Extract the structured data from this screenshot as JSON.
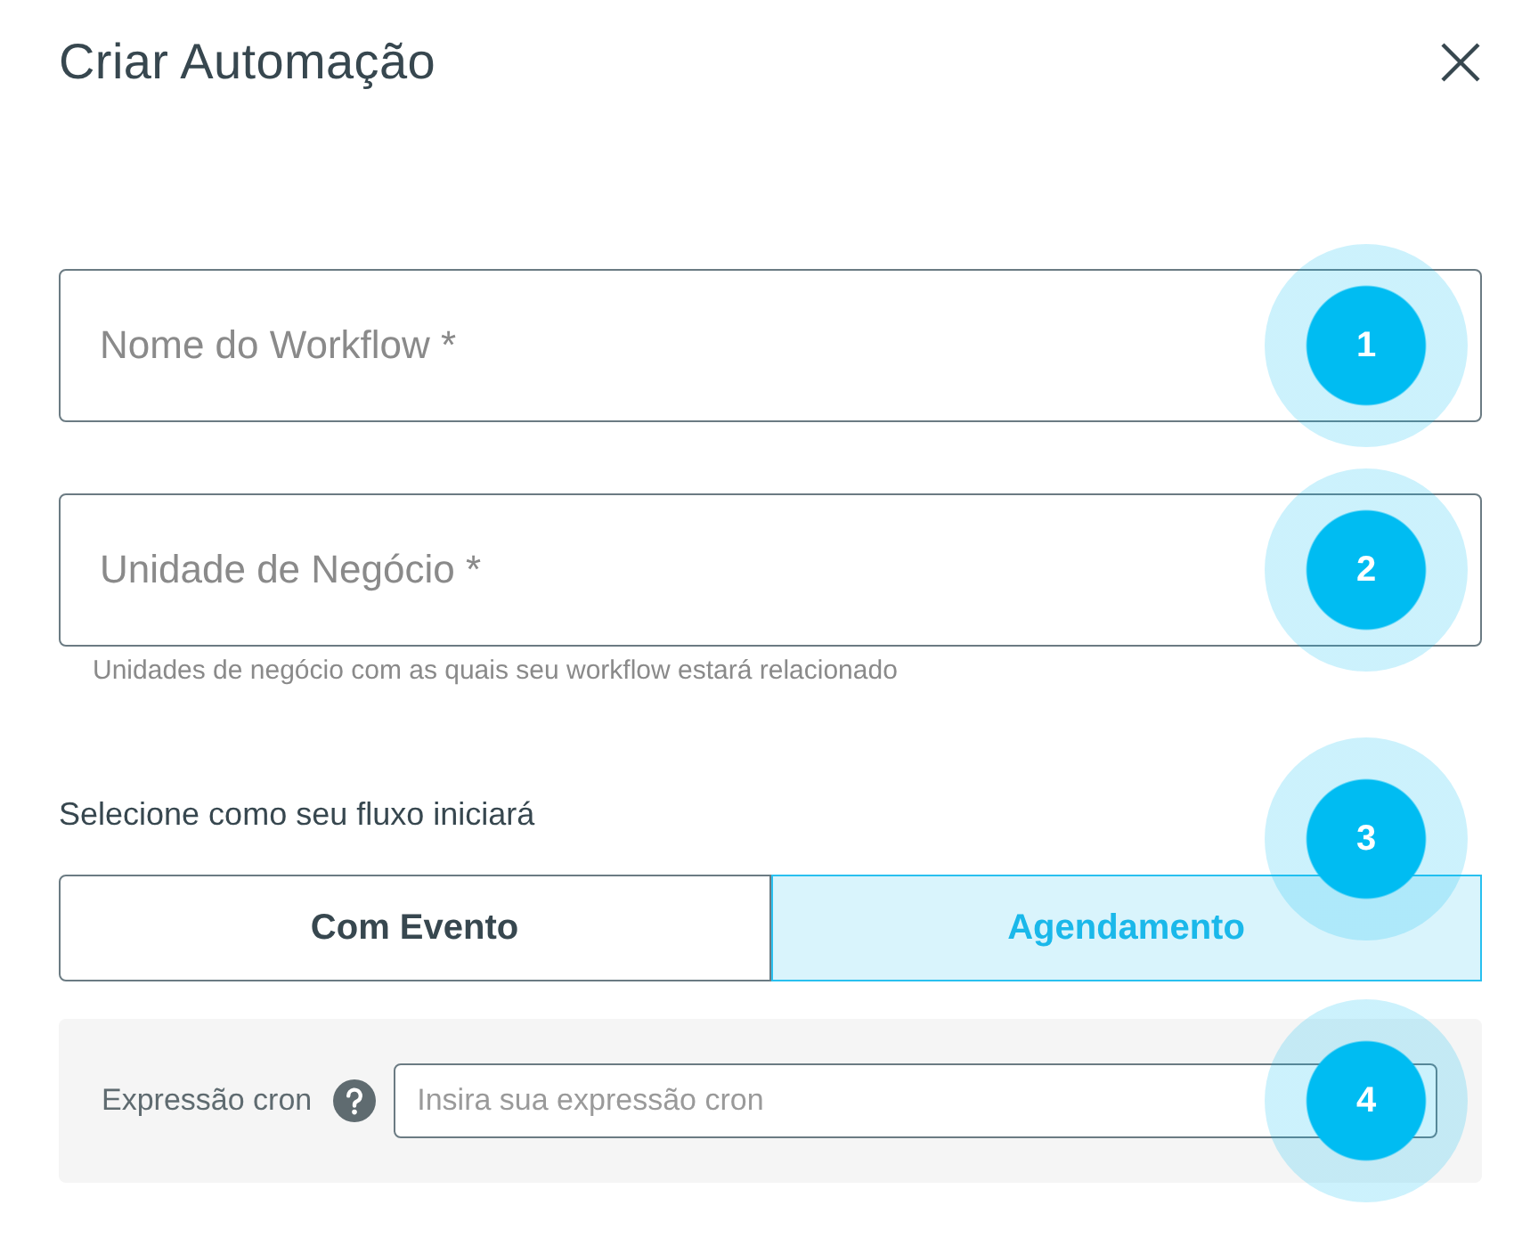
{
  "dialog": {
    "title": "Criar Automação"
  },
  "fields": [
    {
      "placeholder": "Nome do Workflow *",
      "marker": "1"
    },
    {
      "placeholder": "Unidade de Negócio *",
      "helper": "Unidades de negócio com as quais seu workflow estará relacionado",
      "marker": "2"
    }
  ],
  "trigger": {
    "label": "Selecione como seu fluxo iniciará",
    "marker": "3",
    "options": [
      {
        "label": "Com Evento",
        "selected": false
      },
      {
        "label": "Agendamento",
        "selected": true
      }
    ]
  },
  "cron": {
    "label": "Expressão cron",
    "placeholder": "Insira sua expressão cron",
    "marker": "4"
  }
}
